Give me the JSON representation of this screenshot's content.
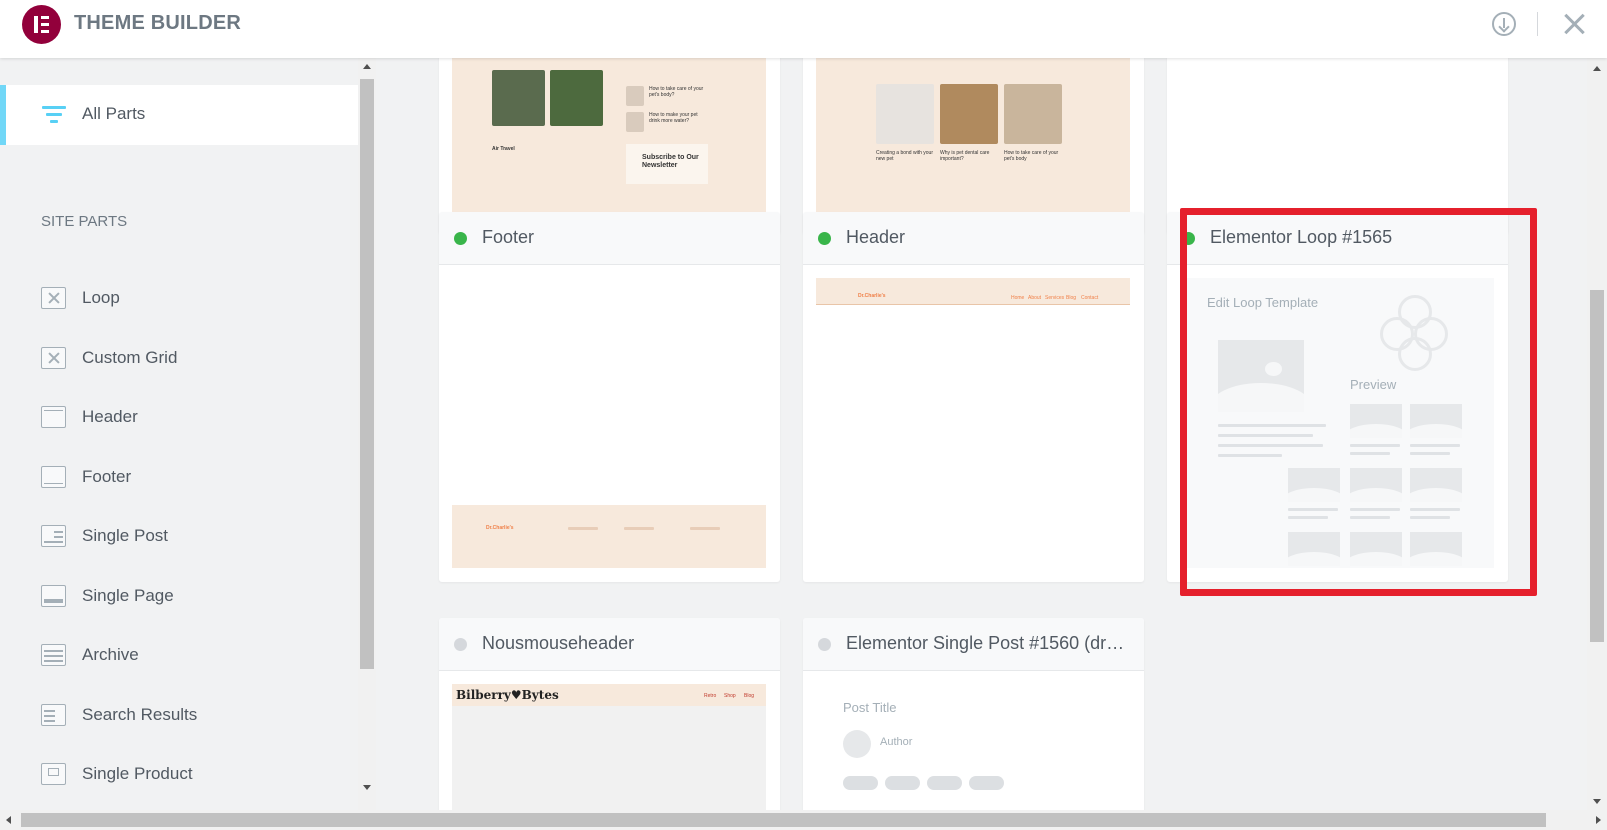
{
  "app": {
    "title": "THEME BUILDER"
  },
  "sidebar": {
    "all_parts_label": "All Parts",
    "section_title": "SITE PARTS",
    "items": [
      {
        "label": "Loop",
        "icon": "loop-icon"
      },
      {
        "label": "Custom Grid",
        "icon": "custom-grid-icon"
      },
      {
        "label": "Header",
        "icon": "header-icon"
      },
      {
        "label": "Footer",
        "icon": "footer-icon"
      },
      {
        "label": "Single Post",
        "icon": "single-post-icon"
      },
      {
        "label": "Single Page",
        "icon": "single-page-icon"
      },
      {
        "label": "Archive",
        "icon": "archive-icon"
      },
      {
        "label": "Search Results",
        "icon": "search-results-icon"
      },
      {
        "label": "Single Product",
        "icon": "single-product-icon"
      }
    ]
  },
  "cards": [
    {
      "title": "Footer",
      "status": "active"
    },
    {
      "title": "Header",
      "status": "active"
    },
    {
      "title": "Elementor Loop #1565",
      "status": "active",
      "selected": true
    },
    {
      "title": "Nousmouseheader",
      "status": "draft"
    },
    {
      "title": "Elementor Single Post #1560 (dra...",
      "status": "draft"
    }
  ],
  "previews": {
    "top_left": {
      "heading": "Air Travel",
      "side1": "How to take care of your pet's body?",
      "side2": "How to make your pet drink more water?",
      "newsletter": "Subscribe to Our Newsletter"
    },
    "top_middle": {
      "caption1": "Creating a bond with your new pet",
      "caption2": "Why is pet dental care important?",
      "caption3": "How to take care of your pet's body"
    },
    "footer_brand": "Dr.Charlie's",
    "header_brand": "Dr.Charlie's",
    "header_nav": [
      "Home",
      "About",
      "Services",
      "Blog",
      "Contact"
    ],
    "loop": {
      "edit_label": "Edit Loop Template",
      "preview_label": "Preview"
    },
    "nousmouse": {
      "brand": "Bilberry♥Bytes",
      "nav": [
        "Retro",
        "Shop",
        "Blog"
      ]
    },
    "single_post": {
      "post_title": "Post Title",
      "author": "Author"
    }
  },
  "colors": {
    "accent": "#92003b",
    "selected_border": "#e5202c",
    "active_dot": "#39b54a",
    "sidebar_accent": "#71d7f7"
  }
}
